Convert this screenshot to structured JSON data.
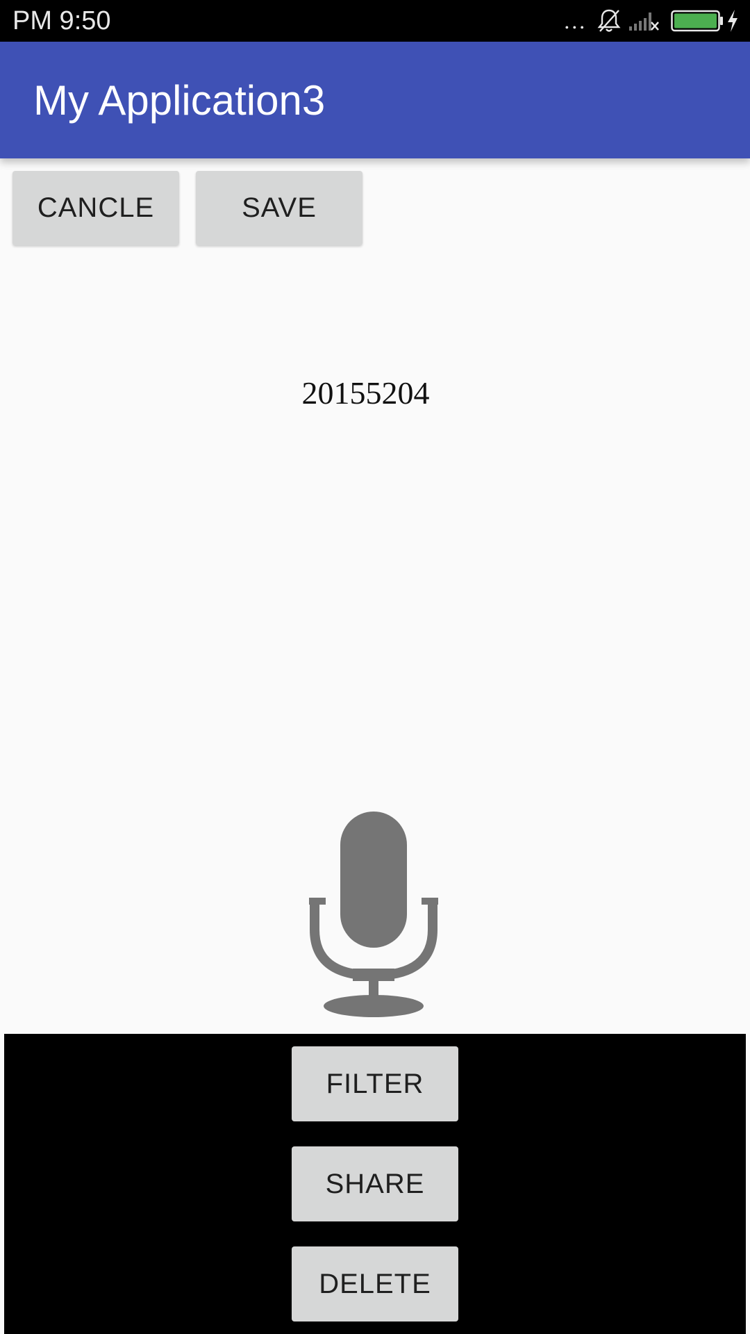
{
  "status_bar": {
    "time": "PM 9:50",
    "overflow": "...",
    "icons": [
      "bell-off-icon",
      "signal-icon",
      "battery-icon",
      "charging-icon"
    ],
    "battery_color": "#4caf50"
  },
  "app_bar": {
    "title": "My Application3",
    "color": "#3f51b5"
  },
  "top_buttons": {
    "cancel_label": "CANCLE",
    "save_label": "SAVE"
  },
  "content": {
    "id_text": "20155204",
    "center_icon": "microphone-icon"
  },
  "bottom_panel": {
    "filter_label": "FILTER",
    "share_label": "SHARE",
    "delete_label": "DELETE"
  }
}
